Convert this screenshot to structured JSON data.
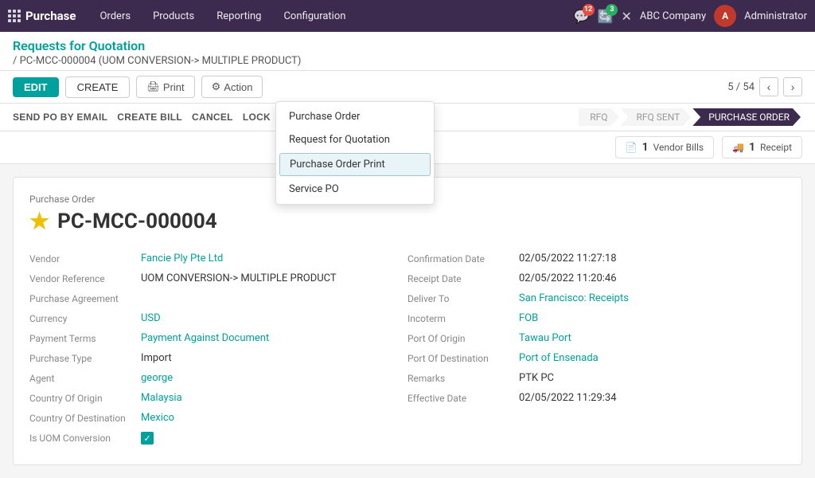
{
  "topnav": {
    "app_name": "Purchase",
    "menu_items": [
      "Orders",
      "Products",
      "Reporting",
      "Configuration"
    ],
    "notifications_count": "12",
    "tasks_count": "3",
    "company": "ABC Company",
    "admin_initial": "A",
    "admin_name": "Administrator"
  },
  "breadcrumb": {
    "parent": "Requests for Quotation",
    "current": "/ PC-MCC-000004 (UOM CONVERSION-> MULTIPLE PRODUCT)"
  },
  "toolbar": {
    "edit_label": "EDIT",
    "create_label": "CREATE",
    "print_label": "Print",
    "action_label": "Action",
    "pagination": "5 / 54"
  },
  "dropdown": {
    "items": [
      {
        "label": "Purchase Order",
        "highlighted": false
      },
      {
        "label": "Request for Quotation",
        "highlighted": false
      },
      {
        "label": "Purchase Order Print",
        "highlighted": true
      },
      {
        "label": "Service PO",
        "highlighted": false
      }
    ]
  },
  "sub_toolbar": {
    "buttons": [
      "SEND PO BY EMAIL",
      "CREATE BILL",
      "CANCEL",
      "LOCK"
    ]
  },
  "status_trail": {
    "steps": [
      "RFQ",
      "RFQ SENT",
      "PURCHASE ORDER"
    ],
    "active": "PURCHASE ORDER"
  },
  "stat_buttons": {
    "vendor_bills": {
      "count": "1",
      "label": "Vendor Bills"
    },
    "receipt": {
      "count": "1",
      "label": "Receipt"
    }
  },
  "document": {
    "type_label": "Purchase Order",
    "order_number": "PC-MCC-000004",
    "fields_left": [
      {
        "label": "Vendor",
        "value": "Fancie Ply Pte Ltd",
        "link": true
      },
      {
        "label": "Vendor Reference",
        "value": "UOM CONVERSION-> MULTIPLE PRODUCT",
        "link": false
      },
      {
        "label": "Purchase Agreement",
        "value": "",
        "link": false
      },
      {
        "label": "Currency",
        "value": "USD",
        "link": true
      },
      {
        "label": "Payment Terms",
        "value": "Payment Against Document",
        "link": true
      },
      {
        "label": "Purchase Type",
        "value": "Import",
        "link": false
      },
      {
        "label": "Agent",
        "value": "george",
        "link": true
      },
      {
        "label": "Country Of Origin",
        "value": "Malaysia",
        "link": true
      },
      {
        "label": "Country Of Destination",
        "value": "Mexico",
        "link": true
      },
      {
        "label": "Is UOM Conversion",
        "value": "checkbox",
        "link": false
      }
    ],
    "fields_right": [
      {
        "label": "Confirmation Date",
        "value": "02/05/2022 11:27:18",
        "link": false
      },
      {
        "label": "Receipt Date",
        "value": "02/05/2022 11:20:46",
        "link": false
      },
      {
        "label": "Deliver To",
        "value": "San Francisco: Receipts",
        "link": true
      },
      {
        "label": "Incoterm",
        "value": "FOB",
        "link": true
      },
      {
        "label": "Port Of Origin",
        "value": "Tawau Port",
        "link": true
      },
      {
        "label": "Port Of Destination",
        "value": "Port of Ensenada",
        "link": true
      },
      {
        "label": "Remarks",
        "value": "PTK PC",
        "link": false
      },
      {
        "label": "Effective Date",
        "value": "02/05/2022 11:29:34",
        "link": false
      }
    ]
  }
}
